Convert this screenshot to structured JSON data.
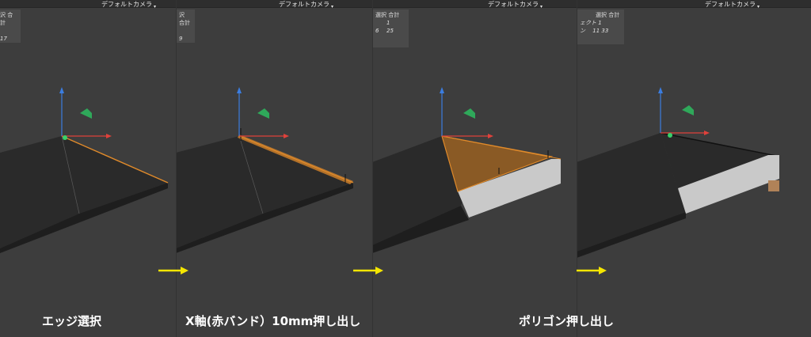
{
  "panels": [
    {
      "camera_label": "デフォルトカメラ",
      "stats": {
        "header": "沢 合計",
        "rows": [
          [
            "",
            "17"
          ]
        ]
      }
    },
    {
      "camera_label": "デフォルトカメラ",
      "stats": {
        "header": "沢 合計",
        "rows": [
          [
            "",
            "9"
          ]
        ]
      }
    },
    {
      "camera_label": "デフォルトカメラ",
      "stats": {
        "header": "選択 合計",
        "rows": [
          [
            "",
            "1"
          ],
          [
            "6",
            "25"
          ]
        ]
      }
    },
    {
      "camera_label": "デフォルトカメラ",
      "stats": {
        "header": "選択 合計",
        "rows": [
          [
            "ェクト",
            "1"
          ],
          [
            "ン",
            "11   33"
          ]
        ]
      }
    }
  ],
  "captions": {
    "edge_select": "エッジ選択",
    "x_axis_extrude": "X軸(赤バンド）10mm押し出し",
    "polygon_extrude": "ポリゴン押し出し"
  },
  "colors": {
    "background": "#3d3d3d",
    "selection_orange": "#e08a2a",
    "arrow_yellow": "#f5e600",
    "gizmo_blue": "#3b7de0",
    "gizmo_red": "#e0413b",
    "gizmo_green": "#2fa85a"
  }
}
